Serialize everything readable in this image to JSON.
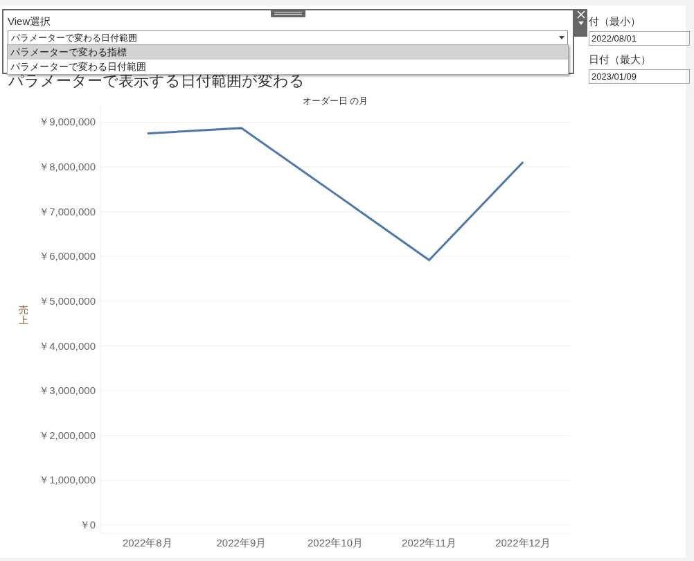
{
  "sheet_title": "パラメーターで表示する日付範囲が変わる",
  "view_selector": {
    "title": "View選択",
    "value": "パラメーターで変わる日付範囲",
    "expanded": true,
    "options": [
      {
        "label": "パラメーターで変わる指標",
        "highlighted": true
      },
      {
        "label": "パラメーターで変わる日付範囲",
        "highlighted": false
      }
    ]
  },
  "parameters": [
    {
      "label": "付（最小）",
      "value": "2022/08/01"
    },
    {
      "label": "日付（最大）",
      "value": "2023/01/09"
    }
  ],
  "chart": {
    "chart_data": {
      "type": "line",
      "title": "オーダー日 の月",
      "ylabel": "売上",
      "categories": [
        "2022年8月",
        "2022年9月",
        "2022年10月",
        "2022年11月",
        "2022年12月"
      ],
      "series": [
        {
          "color": "#4e79a7",
          "values": [
            8750000,
            8870000,
            7400000,
            5920000,
            8110000
          ]
        }
      ],
      "ylim": [
        0,
        9410000
      ],
      "grid": true,
      "yticks": [
        {
          "value": 0,
          "label": "￥0"
        },
        {
          "value": 1000000,
          "label": "￥1,000,000"
        },
        {
          "value": 2000000,
          "label": "￥2,000,000"
        },
        {
          "value": 3000000,
          "label": "￥3,000,000"
        },
        {
          "value": 4000000,
          "label": "￥4,000,000"
        },
        {
          "value": 5000000,
          "label": "￥5,000,000"
        },
        {
          "value": 6000000,
          "label": "￥6,000,000"
        },
        {
          "value": 7000000,
          "label": "￥7,000,000"
        },
        {
          "value": 8000000,
          "label": "￥8,000,000"
        },
        {
          "value": 9000000,
          "label": "￥9,000,000"
        }
      ]
    }
  }
}
